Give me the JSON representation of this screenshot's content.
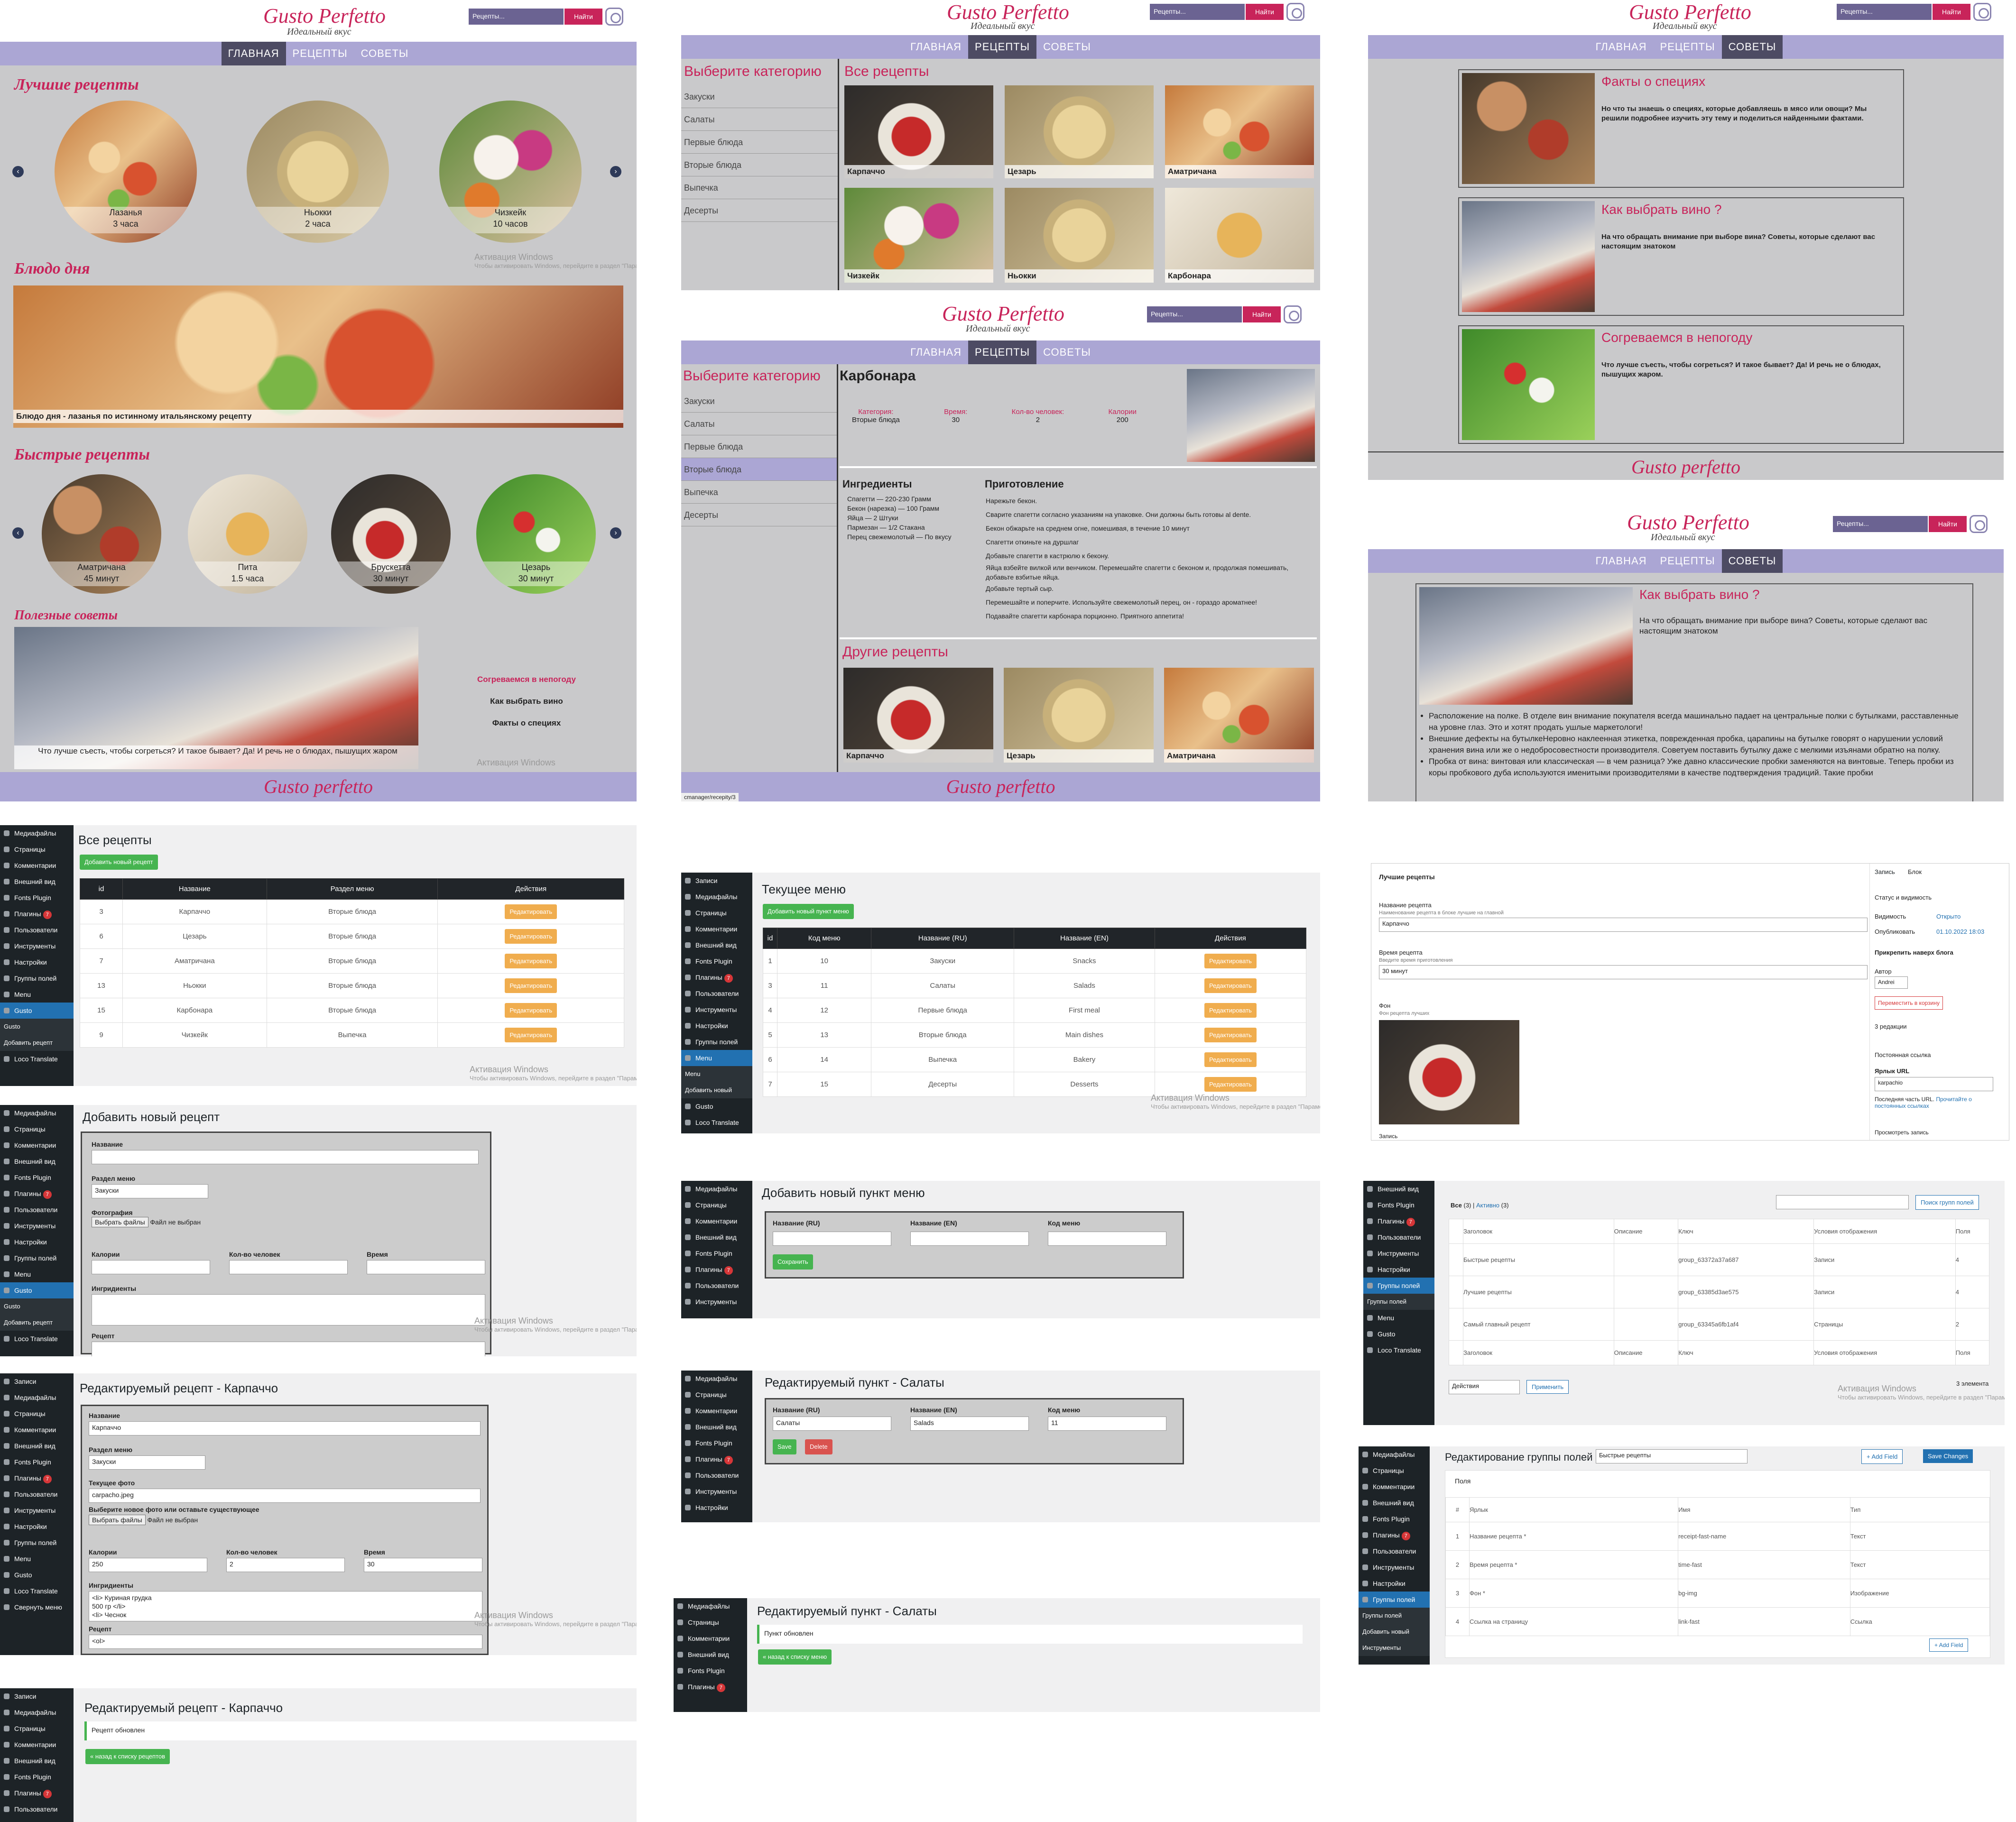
{
  "site": {
    "logo": "Gusto Perfetto",
    "tagline": "Идеальный вкус",
    "search_placeholder": "Рецепты...",
    "search_button": "Найти",
    "nav": [
      "ГЛАВНАЯ",
      "РЕЦЕПТЫ",
      "СОВЕТЫ"
    ],
    "footer": "Gusto perfetto"
  },
  "home": {
    "best_title": "Лучшие рецепты",
    "best": [
      {
        "name": "Лазанья",
        "time": "3 часа"
      },
      {
        "name": "Ньокки",
        "time": "2 часа"
      },
      {
        "name": "Чизкейк",
        "time": "10 часов"
      }
    ],
    "dish_title": "Блюдо дня",
    "dish_caption": "Блюдо дня - лазанья по истинному итальянскому рецепту",
    "fast_title": "Быстрые рецепты",
    "fast": [
      {
        "name": "Аматричана",
        "time": "45 минут"
      },
      {
        "name": "Пита",
        "time": "1.5 часа"
      },
      {
        "name": "Брускетта",
        "time": "30 минут"
      },
      {
        "name": "Цезарь",
        "time": "30 минут"
      }
    ],
    "tips_title": "Полезные советы",
    "tip_caption": "Что лучше съесть, чтобы согреться? И такое бывает? Да! И речь не о блюдах, пышущих жаром",
    "tips_links": [
      "Согреваемся в непогоду",
      "Как выбрать вино",
      "Факты о специях"
    ]
  },
  "watermark": {
    "title": "Активация Windows",
    "sub": "Чтобы активировать Windows, перейдите в раздел \"Параметры\"."
  },
  "catalog": {
    "cat_title": "Выберите категорию",
    "categories": [
      "Закуски",
      "Салаты",
      "Первые блюда",
      "Вторые блюда",
      "Выпечка",
      "Десерты"
    ],
    "all_title": "Все рецепты",
    "recipes": [
      "Карпаччо",
      "Цезарь",
      "Аматричана",
      "Чизкейк",
      "Ньокки",
      "Карбонара"
    ]
  },
  "tips": [
    {
      "title": "Факты о специях",
      "text": "Но что ты знаешь о специях, которые добавляешь в мясо или овощи? Мы решили подробнее изучить эту тему и поделиться найденными фактами."
    },
    {
      "title": "Как выбрать вино ?",
      "text": "На что обращать внимание при выборе вина? Советы, которые сделают вас настоящим знатоком"
    },
    {
      "title": "Согреваемся в непогоду",
      "text": "Что лучше съесть, чтобы согреться? И такое бывает? Да! И речь не о блюдах, пышущих жаром."
    }
  ],
  "recipe": {
    "title": "Карбонара",
    "meta_labels": [
      "Категория:",
      "Время:",
      "Кол-во человек:",
      "Калории"
    ],
    "meta_values": [
      "Вторые блюда",
      "30",
      "2",
      "200"
    ],
    "ingr_title": "Ингредиенты",
    "ingredients": [
      "Спагетти — 220-230 Грамм",
      "Бекон (нарезка) — 100 Грамм",
      "Яйца — 2 Штуки",
      "Пармезан — 1/2 Стакана",
      "Перец свежемолотый — По вкусу"
    ],
    "prep_title": "Приготовление",
    "steps": [
      "Нарежьте бекон.",
      "Сварите спагетти согласно указаниям на упаковке. Они должны быть готовы al dente.",
      "Бекон обжарьте на среднем огне, помешивая, в течение 10 минут",
      "Спагетти откиньте на дуршлаг",
      "Добавьте спагетти в кастрюлю к бекону.",
      "Яйца взбейте вилкой или венчиком. Перемешайте спагетти с беконом и, продолжая помешивать, добавьте взбитые яйца.",
      "Добавьте тертый сыр.",
      "Перемешайте и поперчите. Используйте свежемолотый перец, он - гораздо ароматнее!",
      "Подавайте спагетти карбонара порционно. Приятного аппетита!"
    ],
    "other_title": "Другие рецепты",
    "other": [
      "Карпаччо",
      "Цезарь",
      "Аматричана"
    ],
    "status_url": "cmanager/recepity/3"
  },
  "wine": {
    "title": "Как выбрать вино ?",
    "intro": "На что обращать внимание при выборе вина? Советы, которые сделают вас настоящим знатоком",
    "bullets": [
      "Расположение на полке. В отделе вин внимание покупателя всегда машинально падает на центральные полки с бутылками, расставленные на уровне глаз. Это и хотят продать ушлые маркетологи!",
      "Внешние дефекты на бутылкеНеровно наклеенная этикетка, поврежденная пробка, царапины на бутылке говорят о нарушении условий хранения вина или же о недобросовестности производителя. Советуем поставить бутылку даже с мелкими изъянами обратно на полку.",
      "Пробка от вина: винтовая или классическая — в чем разница? Уже давно классические пробки заменяются на винтовые. Теперь пробки из коры пробкового дуба используются именитыми производителями в качестве подтверждения традиций. Такие пробки"
    ]
  },
  "admin": {
    "menu": [
      "Медиафайлы",
      "Страницы",
      "Комментарии",
      "Внешний вид",
      "Fonts Plugin",
      "Плагины",
      "Пользователи",
      "Инструменты",
      "Настройки",
      "Группы полей",
      "Menu",
      "Gusto"
    ],
    "menu_extra": [
      "Записи",
      "Loco Translate",
      "Свернуть меню",
      "Добавить новый",
      "Добавить рецепт"
    ],
    "badge": "7",
    "recipes_title": "Все рецепты",
    "add_recipe_btn": "Добавить новый рецепт",
    "recipe_cols": [
      "id",
      "Название",
      "Раздел меню",
      "Действия"
    ],
    "recipe_rows": [
      [
        "3",
        "Карпаччо",
        "Вторые блюда"
      ],
      [
        "6",
        "Цезарь",
        "Вторые блюда"
      ],
      [
        "7",
        "Аматричана",
        "Вторые блюда"
      ],
      [
        "13",
        "Ньокки",
        "Вторые блюда"
      ],
      [
        "15",
        "Карбонара",
        "Вторые блюда"
      ],
      [
        "9",
        "Чизкейк",
        "Выпечка"
      ]
    ],
    "edit_btn": "Редактировать",
    "add_title": "Добавить новый рецепт",
    "f_name": "Название",
    "f_section": "Раздел меню",
    "f_section_val": "Закуски",
    "f_photo": "Фотография",
    "f_file_btn": "Выбрать файлы",
    "f_file_none": "Файл не выбран",
    "f_cal": "Калории",
    "f_people": "Кол-во человек",
    "f_time": "Время",
    "f_ingr": "Ингридиенты",
    "f_recipe": "Рецепт",
    "edit_title": "Редактируемый рецепт - Карпаччо",
    "e_name": "Карпаччо",
    "e_photo_label": "Текущее фото",
    "e_photo": "carpacho.jpeg",
    "e_new_photo": "Выберите новое фото или оставьте существующее",
    "e_cal": "250",
    "e_people": "2",
    "e_time": "30",
    "e_ingr": [
      "<li> Куриная грудка",
      "500 гр </li>",
      "<li> Чеснок"
    ],
    "e_recipe": "<ol>",
    "updated_title": "Редактируемый рецепт - Карпаччо",
    "updated_msg": "Рецепт обновлен",
    "back_recipes": "« назад к списку рецептов",
    "menu_title": "Текущее меню",
    "add_menu_btn": "Добавить новый пункт меню",
    "menu_cols": [
      "id",
      "Код меню",
      "Название (RU)",
      "Название (EN)",
      "Действия"
    ],
    "menu_rows": [
      [
        "1",
        "10",
        "Закуски",
        "Snacks"
      ],
      [
        "3",
        "11",
        "Салаты",
        "Salads"
      ],
      [
        "4",
        "12",
        "Первые блюда",
        "First meal"
      ],
      [
        "5",
        "13",
        "Вторые блюда",
        "Main dishes"
      ],
      [
        "6",
        "14",
        "Выпечка",
        "Bakery"
      ],
      [
        "7",
        "15",
        "Десерты",
        "Desserts"
      ]
    ],
    "add_menu_title": "Добавить новый пункт меню",
    "m_ru": "Название (RU)",
    "m_en": "Название (EN)",
    "m_code": "Код меню",
    "save": "Сохранить",
    "edit_menu_title": "Редактируемый пункт - Салаты",
    "em_ru": "Салаты",
    "em_en": "Salads",
    "em_code": "11",
    "save_btn": "Save",
    "delete_btn": "Delete",
    "menu_updated_title": "Редактируемый пункт - Салаты",
    "menu_updated_msg": "Пункт обновлен",
    "back_menu": "« назад к списку меню"
  },
  "gb": {
    "block": "Лучшие рецепты",
    "f1": "Название рецепта",
    "f1_hint": "Наименование рецепта в блоке лучшие на главной",
    "f1_val": "Карпаччо",
    "f2": "Время рецепта",
    "f2_hint": "Введите время приготовления",
    "f2_val": "30 минут",
    "f3": "Фон",
    "f3_hint": "Фон рецепта лучших",
    "footer": "Запись",
    "tabs": [
      "Запись",
      "Блок"
    ],
    "status": "Статус и видимость",
    "vis": "Видимость",
    "vis_val": "Открыто",
    "pub": "Опубликовать",
    "pub_val": "01.10.2022 18:03",
    "pin": "Прикрепить наверх блога",
    "author": "Автор",
    "author_val": "Andrei",
    "trash": "Переместить в корзину",
    "rev": "3 редакции",
    "perma": "Постоянная ссылка",
    "url_label": "Ярлык URL",
    "url_val": "karpachio",
    "url_text": "Последняя часть URL.",
    "url_link": "Прочитайте о постоянных ссылках",
    "view": "Просмотреть запись"
  },
  "acf": {
    "all": "Все",
    "all_count": "(3)",
    "active": "Активно",
    "active_count": "(3)",
    "search_btn": "Поиск групп полей",
    "cols": [
      "Заголовок",
      "Описание",
      "Ключ",
      "Условия отображения",
      "Поля"
    ],
    "rows": [
      [
        "Быстрые рецепты",
        "group_63372a37a687",
        "Записи",
        "4"
      ],
      [
        "Лучшие рецепты",
        "group_63385d3ae575",
        "Записи",
        "4"
      ],
      [
        "Самый главный рецепт",
        "group_63345a6fb1af4",
        "Страницы",
        "2"
      ]
    ],
    "bulk": "Действия",
    "apply": "Применить",
    "count": "3 элемента",
    "edit_title": "Редактирование группы полей",
    "edit_name": "Быстрые рецепты",
    "add_field": "+ Add Field",
    "save_changes": "Save Changes",
    "fields_label": "Поля",
    "fcols": [
      "#",
      "Ярлык",
      "Имя",
      "Тип"
    ],
    "frows": [
      [
        "1",
        "Название рецепта *",
        "receipt-fast-name",
        "Текст"
      ],
      [
        "2",
        "Время рецепта *",
        "time-fast",
        "Текст"
      ],
      [
        "3",
        "Фон *",
        "bg-img",
        "Изображение"
      ],
      [
        "4",
        "Ссылка на страницу",
        "link-fast",
        "Ссылка"
      ]
    ]
  }
}
